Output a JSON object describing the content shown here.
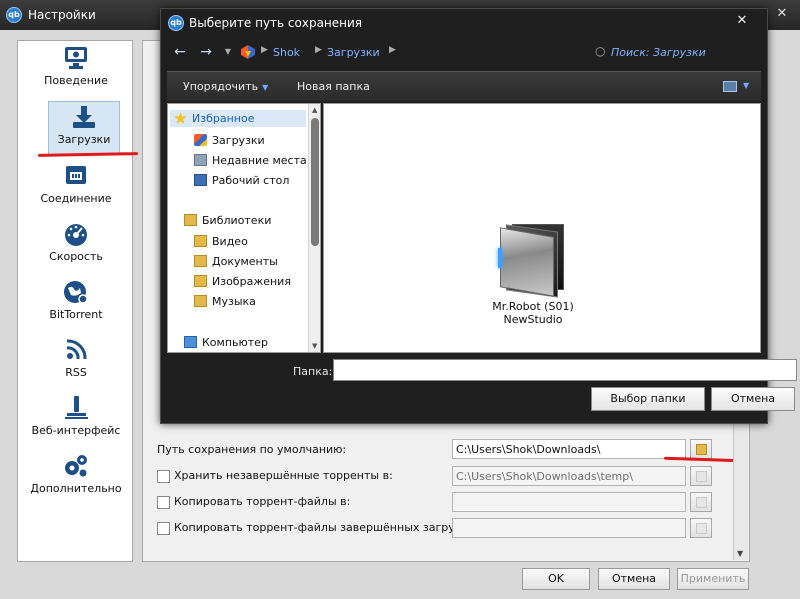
{
  "settings_window": {
    "title": "Настройки",
    "close": "✕",
    "sidebar": [
      {
        "label": "Поведение",
        "icon": "monitor-icon"
      },
      {
        "label": "Загрузки",
        "icon": "download-icon",
        "selected": true
      },
      {
        "label": "Соединение",
        "icon": "network-icon"
      },
      {
        "label": "Скорость",
        "icon": "speedometer-icon"
      },
      {
        "label": "BitTorrent",
        "icon": "globe-icon"
      },
      {
        "label": "RSS",
        "icon": "rss-icon"
      },
      {
        "label": "Веб-интерфейс",
        "icon": "web-ui-icon"
      },
      {
        "label": "Дополнительно",
        "icon": "gears-icon"
      }
    ],
    "downloads": {
      "default_path_label": "Путь сохранения по умолчанию:",
      "default_path_value": "C:\\Users\\Shok\\Downloads\\",
      "keep_incomplete_label": "Хранить незавершённые торренты в:",
      "keep_incomplete_value": "C:\\Users\\Shok\\Downloads\\temp\\",
      "copy_torrent_label": "Копировать торрент-файлы в:",
      "copy_finished_label": "Копировать торрент-файлы завершённых загрузок в:"
    },
    "buttons": {
      "ok": "OK",
      "cancel": "Отмена",
      "apply": "Применить"
    }
  },
  "dialog": {
    "title": "Выберите путь сохранения",
    "close": "✕",
    "breadcrumb": [
      "Shok",
      "Загрузки"
    ],
    "search_placeholder": "Поиск: Загрузки",
    "toolbar": {
      "organize": "Упорядочить",
      "new_folder": "Новая папка"
    },
    "tree": {
      "favorites_header": "Избранное",
      "favorites": [
        "Загрузки",
        "Недавние места",
        "Рабочий стол"
      ],
      "libraries_header": "Библиотеки",
      "libraries": [
        "Видео",
        "Документы",
        "Изображения",
        "Музыка"
      ],
      "computer": "Компьютер"
    },
    "file_item": {
      "name_line1": "Mr.Robot (S01)",
      "name_line2": "NewStudio"
    },
    "folder_label": "Папка:",
    "folder_value": "",
    "select_folder_button": "Выбор папки",
    "cancel_button": "Отмена"
  },
  "colors": {
    "accent_red": "#e01a1a",
    "link_blue": "#7fb4ff",
    "selection": "#d6e6f5"
  }
}
